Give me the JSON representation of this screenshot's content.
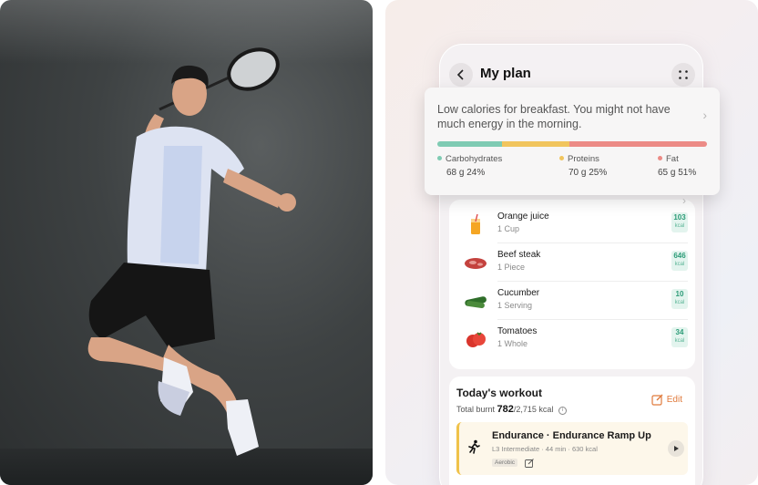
{
  "photo": {
    "image_description": "",
    "colors": {
      "background": "#3e4243",
      "floor": "#1e2122"
    }
  },
  "app": {
    "header": {
      "title": "My plan",
      "back_icon": "chevron-left-icon",
      "grid_icon": "grid-dots-icon"
    },
    "tip": {
      "message": "Low calories for breakfast. You might not have much energy in the morning.",
      "macro_bar_fraction": {
        "carbohydrates": 0.24,
        "proteins": 0.25,
        "fat": 0.51
      },
      "macros": [
        {
          "name": "Carbohydrates",
          "value": "68 g 24%",
          "color": "#7fcbb3"
        },
        {
          "name": "Proteins",
          "value": "70 g 25%",
          "color": "#f1c55e"
        },
        {
          "name": "Fat",
          "value": "65 g 51%",
          "color": "#ec8b86"
        }
      ]
    },
    "foods": [
      {
        "name": "Orange juice",
        "qty": "1 Cup",
        "kcal": "103",
        "unit": "kcal",
        "icon": "juice-glass-icon"
      },
      {
        "name": "Beef steak",
        "qty": "1 Piece",
        "kcal": "646",
        "unit": "kcal",
        "icon": "steak-icon"
      },
      {
        "name": "Cucumber",
        "qty": "1 Serving",
        "kcal": "10",
        "unit": "kcal",
        "icon": "cucumber-icon"
      },
      {
        "name": "Tomatoes",
        "qty": "1 Whole",
        "kcal": "34",
        "unit": "kcal",
        "icon": "tomato-icon"
      }
    ],
    "workout": {
      "title": "Today's workout",
      "burnt_label": "Total burnt",
      "burnt_value": "782",
      "burnt_total": "/2,715 kcal",
      "edit_label": "Edit",
      "session": {
        "title": "Endurance · Endurance Ramp Up",
        "meta": "L3 Intermediate · 44 min · 630 kcal",
        "tag": "Aerobic"
      }
    },
    "colors": {
      "accent_orange": "#e07a3c",
      "kcal_green": "#2d9c78",
      "session_bar": "#f0c24a"
    }
  }
}
